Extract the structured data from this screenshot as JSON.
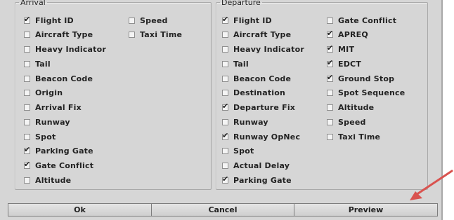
{
  "arrival": {
    "legend": "Arrival",
    "col1": [
      {
        "label": "Flight ID",
        "checked": true
      },
      {
        "label": "Aircraft Type",
        "checked": false
      },
      {
        "label": "Heavy Indicator",
        "checked": false
      },
      {
        "label": "Tail",
        "checked": false
      },
      {
        "label": "Beacon Code",
        "checked": false
      },
      {
        "label": "Origin",
        "checked": false
      },
      {
        "label": "Arrival Fix",
        "checked": false
      },
      {
        "label": "Runway",
        "checked": false
      },
      {
        "label": "Spot",
        "checked": false
      },
      {
        "label": "Parking Gate",
        "checked": true
      },
      {
        "label": "Gate Conflict",
        "checked": true
      },
      {
        "label": "Altitude",
        "checked": false
      }
    ],
    "col2": [
      {
        "label": "Speed",
        "checked": false
      },
      {
        "label": "Taxi Time",
        "checked": false
      }
    ]
  },
  "departure": {
    "legend": "Departure",
    "col1": [
      {
        "label": "Flight ID",
        "checked": true
      },
      {
        "label": "Aircraft Type",
        "checked": false
      },
      {
        "label": "Heavy Indicator",
        "checked": false
      },
      {
        "label": "Tail",
        "checked": false
      },
      {
        "label": "Beacon Code",
        "checked": false
      },
      {
        "label": "Destination",
        "checked": false
      },
      {
        "label": "Departure Fix",
        "checked": true
      },
      {
        "label": "Runway",
        "checked": false
      },
      {
        "label": "Runway OpNec",
        "checked": true
      },
      {
        "label": "Spot",
        "checked": false
      },
      {
        "label": "Actual Delay",
        "checked": false
      },
      {
        "label": "Parking Gate",
        "checked": true
      }
    ],
    "col2": [
      {
        "label": "Gate Conflict",
        "checked": false
      },
      {
        "label": "APREQ",
        "checked": true
      },
      {
        "label": "MIT",
        "checked": true
      },
      {
        "label": "EDCT",
        "checked": true
      },
      {
        "label": "Ground Stop",
        "checked": true
      },
      {
        "label": "Spot Sequence",
        "checked": false
      },
      {
        "label": "Altitude",
        "checked": false
      },
      {
        "label": "Speed",
        "checked": false
      },
      {
        "label": "Taxi Time",
        "checked": false
      }
    ]
  },
  "buttons": {
    "ok": "Ok",
    "cancel": "Cancel",
    "preview": "Preview"
  },
  "colors": {
    "annotation_arrow": "#d9534f"
  }
}
